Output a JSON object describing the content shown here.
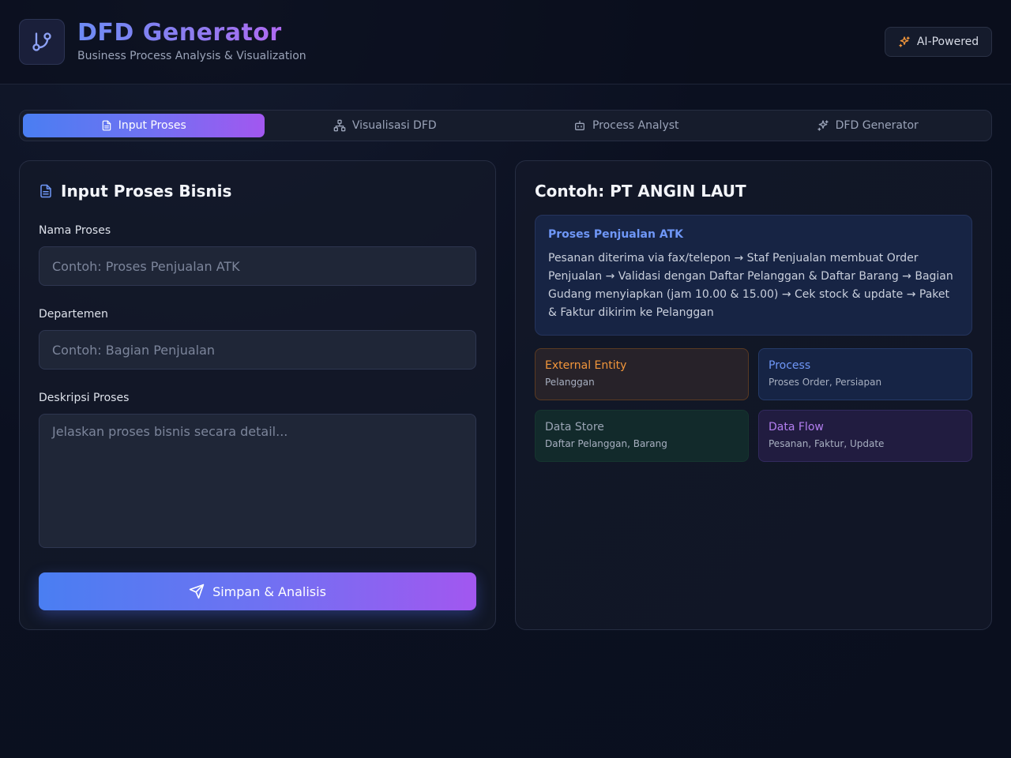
{
  "header": {
    "title": "DFD Generator",
    "subtitle": "Business Process Analysis & Visualization",
    "badge_label": "AI-Powered"
  },
  "tabs": [
    {
      "label": "Input Proses",
      "active": true
    },
    {
      "label": "Visualisasi DFD",
      "active": false
    },
    {
      "label": "Process Analyst",
      "active": false
    },
    {
      "label": "DFD Generator",
      "active": false
    }
  ],
  "form": {
    "title": "Input Proses Bisnis",
    "fields": [
      {
        "label": "Nama Proses",
        "value": "",
        "placeholder": "Contoh: Proses Penjualan ATK"
      },
      {
        "label": "Departemen",
        "value": "",
        "placeholder": "Contoh: Bagian Penjualan"
      },
      {
        "label": "Deskripsi Proses",
        "value": "",
        "placeholder": "Jelaskan proses bisnis secara detail..."
      }
    ],
    "submit_label": "Simpan & Analisis"
  },
  "example": {
    "title": "Contoh: PT ANGIN LAUT",
    "card_heading": "Proses Penjualan ATK",
    "card_description": "Pesanan diterima via fax/telepon → Staf Penjualan membuat Order Penjualan → Validasi dengan Daftar Pelanggan & Daftar Barang → Bagian Gudang menyiapkan (jam 10.00 & 15.00) → Cek stock & update → Paket & Faktur dikirim ke Pelanggan",
    "legend": [
      {
        "title": "External Entity",
        "items": "Pelanggan",
        "color": "#f2963b"
      },
      {
        "title": "Process",
        "items": "Proses Order, Persiapan",
        "color": "#6f97f7"
      },
      {
        "title": "Data Store",
        "items": "Daftar Pelanggan, Barang",
        "color": "#9aa4b4"
      },
      {
        "title": "Data Flow",
        "items": "Pesanan, Faktur, Update",
        "color": "#b37ff0"
      }
    ]
  },
  "colors": {
    "accent_start": "#4a7ef2",
    "accent_end": "#a257f0",
    "background": "#0b1020"
  },
  "icons": {
    "logo": "git-branch-icon",
    "badge": "sparkles-icon",
    "tabs": [
      "file-text-icon",
      "network-icon",
      "bot-icon",
      "sparkles-icon"
    ],
    "form_title": "file-text-icon",
    "submit": "send-icon"
  }
}
